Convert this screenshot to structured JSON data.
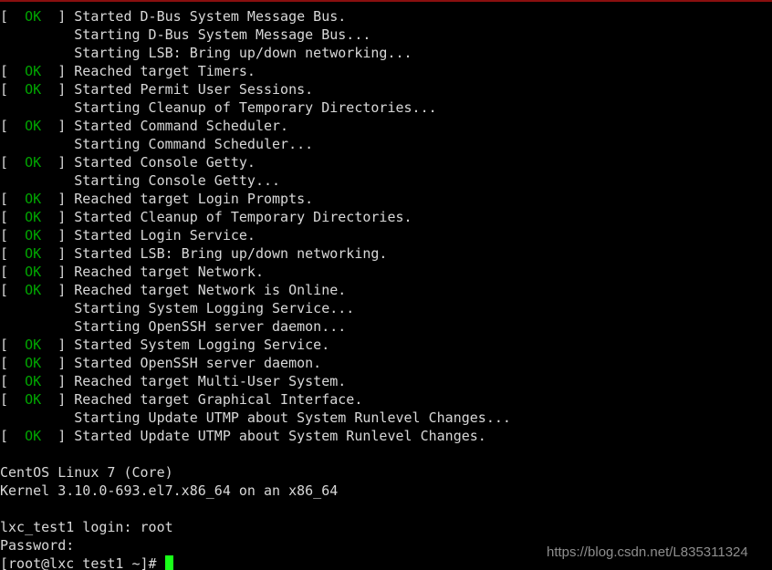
{
  "terminal": {
    "background_color": "#000000",
    "text_color": "#d8d8d8",
    "ok_color": "#00a600",
    "cursor_color": "#19ff19",
    "top_rule_color": "#8a0f0f",
    "status_ok_label": "OK",
    "bracket_open": "[",
    "bracket_close": "]",
    "lines": [
      {
        "type": "status",
        "status": "OK",
        "message": "Started D-Bus System Message Bus."
      },
      {
        "type": "plain",
        "message": "Starting D-Bus System Message Bus..."
      },
      {
        "type": "plain",
        "message": "Starting LSB: Bring up/down networking..."
      },
      {
        "type": "status",
        "status": "OK",
        "message": "Reached target Timers."
      },
      {
        "type": "status",
        "status": "OK",
        "message": "Started Permit User Sessions."
      },
      {
        "type": "plain",
        "message": "Starting Cleanup of Temporary Directories..."
      },
      {
        "type": "status",
        "status": "OK",
        "message": "Started Command Scheduler."
      },
      {
        "type": "plain",
        "message": "Starting Command Scheduler..."
      },
      {
        "type": "status",
        "status": "OK",
        "message": "Started Console Getty."
      },
      {
        "type": "plain",
        "message": "Starting Console Getty..."
      },
      {
        "type": "status",
        "status": "OK",
        "message": "Reached target Login Prompts."
      },
      {
        "type": "status",
        "status": "OK",
        "message": "Started Cleanup of Temporary Directories."
      },
      {
        "type": "status",
        "status": "OK",
        "message": "Started Login Service."
      },
      {
        "type": "status",
        "status": "OK",
        "message": "Started LSB: Bring up/down networking."
      },
      {
        "type": "status",
        "status": "OK",
        "message": "Reached target Network."
      },
      {
        "type": "status",
        "status": "OK",
        "message": "Reached target Network is Online."
      },
      {
        "type": "plain",
        "message": "Starting System Logging Service..."
      },
      {
        "type": "plain",
        "message": "Starting OpenSSH server daemon..."
      },
      {
        "type": "status",
        "status": "OK",
        "message": "Started System Logging Service."
      },
      {
        "type": "status",
        "status": "OK",
        "message": "Started OpenSSH server daemon."
      },
      {
        "type": "status",
        "status": "OK",
        "message": "Reached target Multi-User System."
      },
      {
        "type": "status",
        "status": "OK",
        "message": "Reached target Graphical Interface."
      },
      {
        "type": "plain",
        "message": "Starting Update UTMP about System Runlevel Changes..."
      },
      {
        "type": "status",
        "status": "OK",
        "message": "Started Update UTMP about System Runlevel Changes."
      },
      {
        "type": "blank",
        "message": ""
      },
      {
        "type": "raw",
        "message": "CentOS Linux 7 (Core)"
      },
      {
        "type": "raw",
        "message": "Kernel 3.10.0-693.el7.x86_64 on an x86_64"
      },
      {
        "type": "blank",
        "message": ""
      },
      {
        "type": "raw",
        "message": "lxc_test1 login: root"
      },
      {
        "type": "raw",
        "message": "Password:"
      },
      {
        "type": "prompt",
        "message": "[root@lxc_test1 ~]#"
      }
    ]
  },
  "watermark": {
    "text": "https://blog.csdn.net/L835311324",
    "color": "#8e8e8e"
  }
}
